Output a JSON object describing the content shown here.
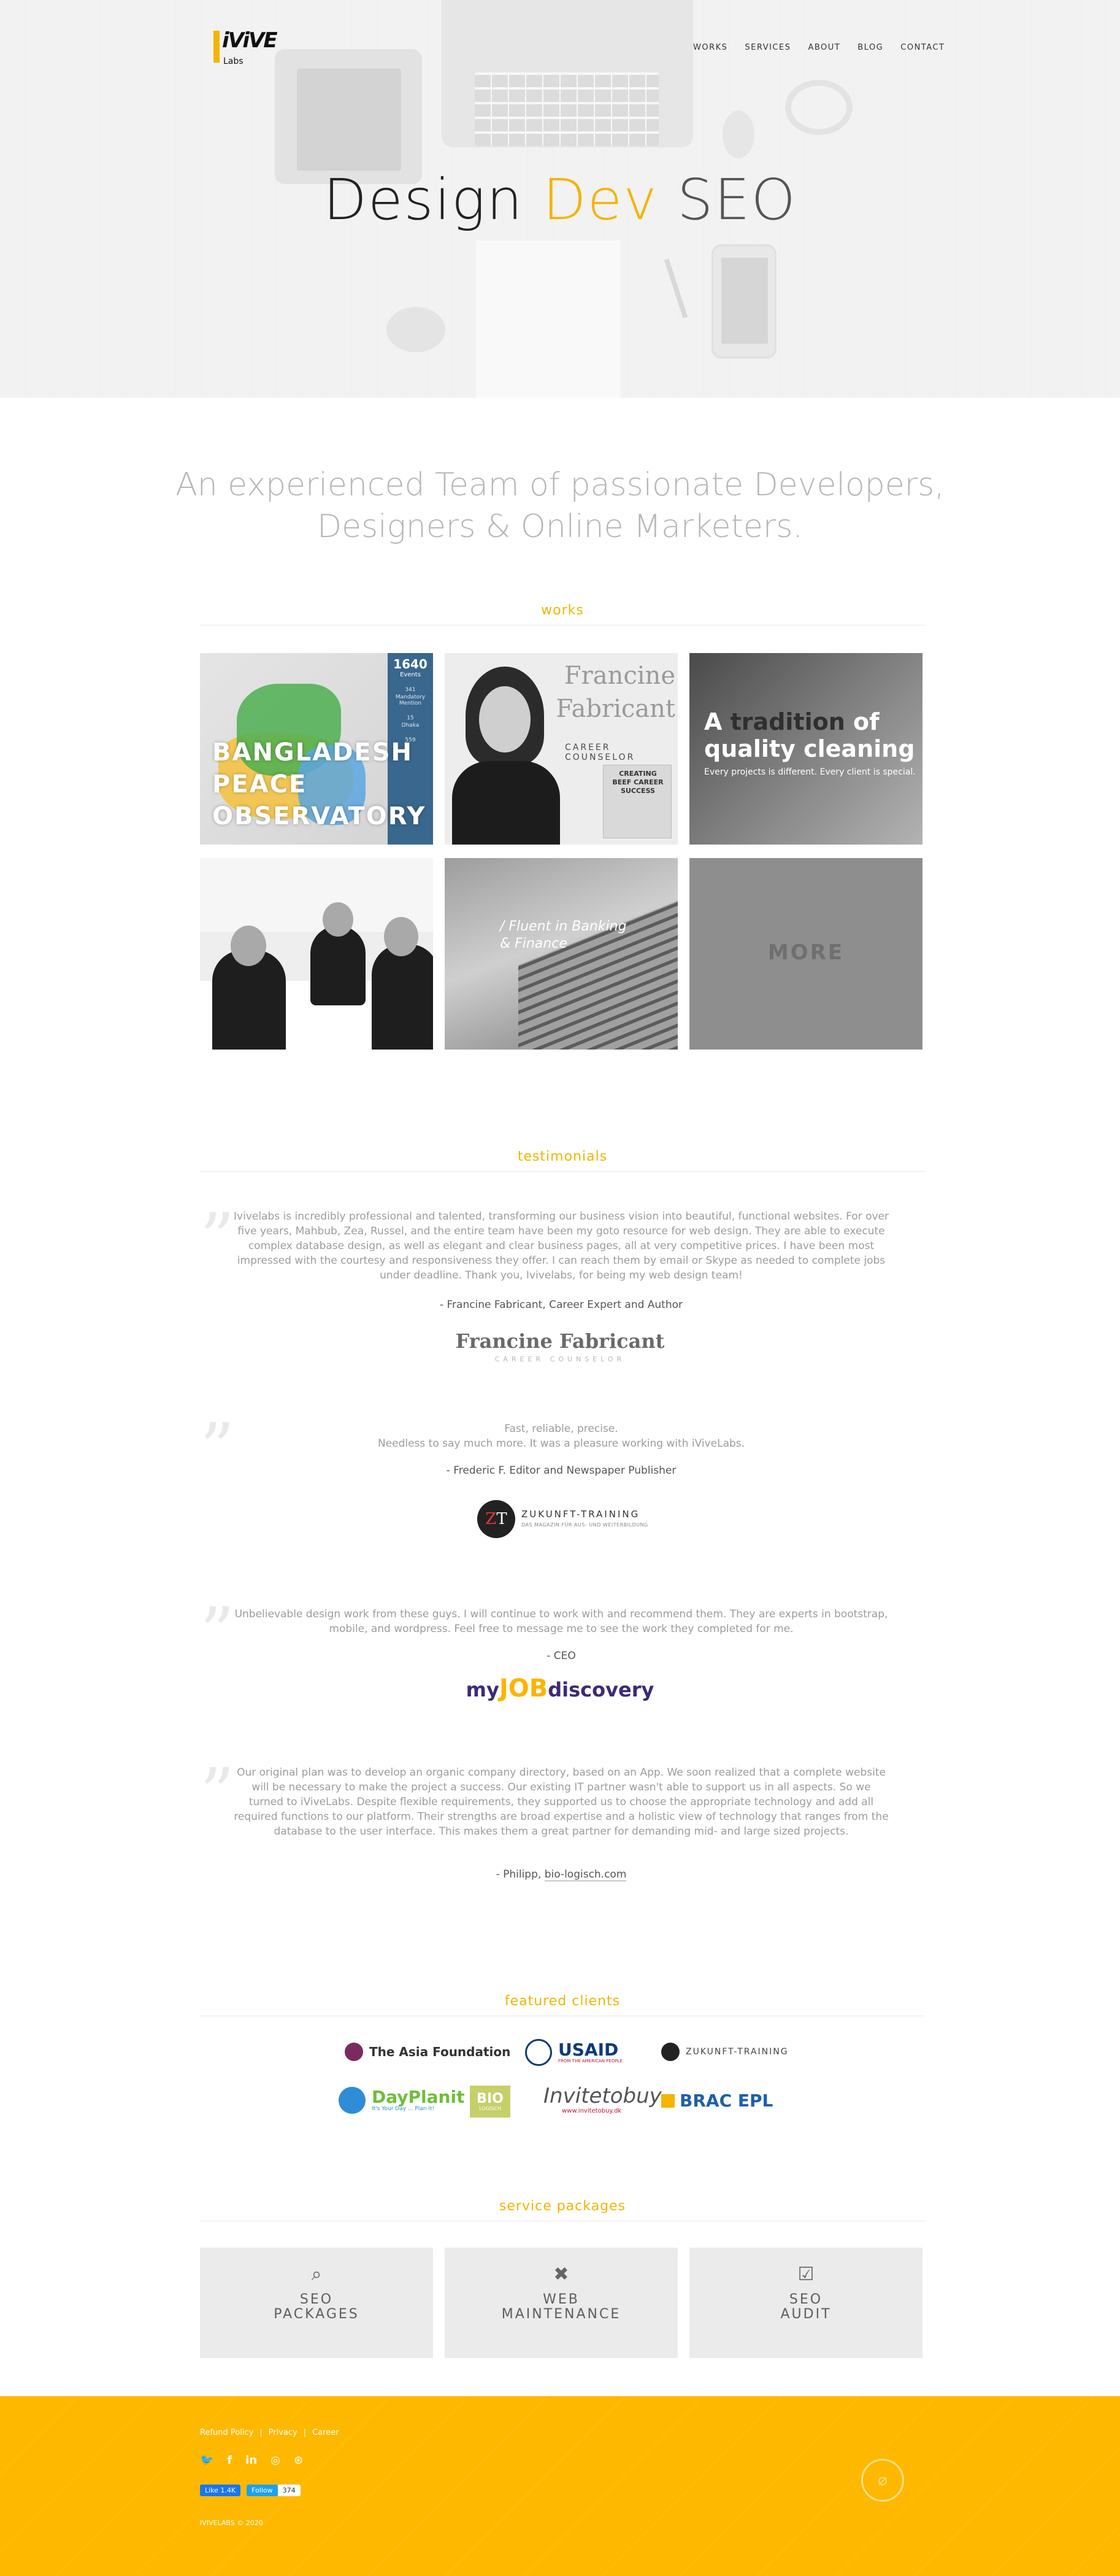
{
  "header": {
    "logo_mark": "iViVE",
    "logo_sub": "Labs",
    "nav": [
      "WORKS",
      "SERVICES",
      "ABOUT",
      "BLOG",
      "CONTACT"
    ]
  },
  "hero": {
    "title_part1": "Design ",
    "title_part2": "Dev",
    "title_part3": " SEO"
  },
  "tagline": "An experienced Team of passionate Developers, Designers & Online Marketers.",
  "works": {
    "heading": "works",
    "tiles": [
      {
        "title": "BANGLADESH PEACE OBSERVATORY",
        "stat_big": "1640",
        "stat_label": "Events",
        "stats": [
          "341",
          "Mandatory Mention",
          "15",
          "Dhaka",
          "559"
        ]
      },
      {
        "name": "Francine Fabricant",
        "subtitle": "CAREER COUNSELOR",
        "book": "CREATING BEEF CAREER SUCCESS"
      },
      {
        "title_a": "A ",
        "title_b": "tradition",
        "title_c": " of quality cleaning",
        "sub": "Every projects is different. Every client is special."
      },
      {
        "alt": "business meeting"
      },
      {
        "text": "/ Fluent in Banking & Finance"
      },
      {
        "text": "MORE"
      }
    ]
  },
  "testimonials": {
    "heading": "testimonials",
    "items": [
      {
        "quote": "Ivivelabs is incredibly professional and talented, transforming our business vision into beautiful, functional websites. For over five years, Mahbub, Zea, Russel, and the entire team have been my goto resource for web design. They are able to execute complex database design, as well as elegant and clear business pages, all at very competitive prices. I have been most impressed with the courtesy and responsiveness they offer. I can reach them by email or Skype as needed to complete jobs under deadline. Thank you, Ivivelabs, for being my web design team!",
        "author": "- Francine Fabricant, Career Expert and Author",
        "logo_name": "Francine Fabricant",
        "logo_sub": "CAREER COUNSELOR"
      },
      {
        "quote_l1": "Fast, reliable, precise.",
        "quote_l2": "Needless to say much more. It was a pleasure working with iViveLabs.",
        "author": "- Frederic F. Editor and Newspaper Publisher",
        "logo_letters": "ZT",
        "logo_name": "ZUKUNFT-TRAINING",
        "logo_sub": "DAS MAGAZIN FÜR AUS- UND WEITERBILDUNG"
      },
      {
        "quote": "Unbelievable design work from these guys. I will continue to work with and recommend them. They are experts in bootstrap, mobile, and wordpress. Feel free to message me to see the work they completed for me.",
        "author": "- CEO",
        "logo_a": "my",
        "logo_b": "JOB",
        "logo_c": "discovery"
      },
      {
        "quote": "Our original plan was to develop an organic company directory, based on an App. We soon realized that a complete website will be necessary to make the project a success. Our existing IT partner wasn't able to support us in all aspects. So we turned to iViveLabs. Despite flexible requirements, they supported us to choose the appropriate technology and add all required functions to our platform. Their strengths are broad expertise and a holistic view of technology that ranges from the database to the user interface. This makes them a great partner for demanding mid- and large sized projects.",
        "author_prefix": "- Philipp, ",
        "author_link": "bio-logisch.com"
      }
    ]
  },
  "clients": {
    "heading": "featured clients",
    "items": [
      "The Asia Foundation",
      "USAID",
      "ZUKUNFT-TRAINING",
      "DayPlanit",
      "BIO",
      "Invitetobuy",
      "BRAC EPL"
    ],
    "usaid_sub": "FROM THE AMERICAN PEOPLE",
    "dayplanit_sub": "It's Your Day ... Plan it!",
    "invite_sub": "www.invitetobuy.dk",
    "bio_sub": "LOGISCH"
  },
  "packages": {
    "heading": "service packages",
    "items": [
      {
        "l1": "SEO",
        "l2": "PACKAGES",
        "icon": "search-icon"
      },
      {
        "l1": "WEB",
        "l2": "MAINTENANCE",
        "icon": "tools-icon"
      },
      {
        "l1": "SEO",
        "l2": "AUDIT",
        "icon": "checkbox-icon"
      }
    ]
  },
  "footer": {
    "links": [
      "Refund Policy",
      "Privacy",
      "Career"
    ],
    "like_label": "Like 1.4K",
    "follow_label": "Follow",
    "follow_count": "374",
    "copyright": "IVIVELABS © 2020"
  },
  "colors": {
    "accent": "#f4b400",
    "footer": "#ffb800",
    "tile_gray": "#ebebeb"
  }
}
